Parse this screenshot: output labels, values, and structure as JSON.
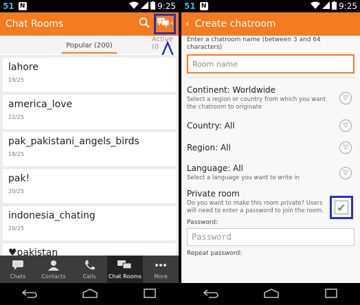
{
  "status": {
    "number": "51",
    "notif_letter": "N",
    "time": "9:25"
  },
  "left": {
    "title": "Chat Rooms",
    "tabs": {
      "popular": "Popular (200)",
      "active": "Active (0"
    },
    "rooms": [
      {
        "name": "lahore",
        "cap": "19/25"
      },
      {
        "name": "america_love",
        "cap": "22/25"
      },
      {
        "name": "pak_pakistani_angels_birds",
        "cap": "18/25"
      },
      {
        "name": "pak!",
        "cap": "20/25"
      },
      {
        "name": "indonesia_chating",
        "cap": "20/25"
      },
      {
        "name": "♥pakistan",
        "cap": ""
      }
    ],
    "nav": [
      {
        "label": "Chats",
        "icon": "chat-bubble-icon"
      },
      {
        "label": "Contacts",
        "icon": "person-icon"
      },
      {
        "label": "Calls",
        "icon": "phone-icon"
      },
      {
        "label": "Chat Rooms",
        "icon": "chat-rooms-icon"
      },
      {
        "label": "More",
        "icon": "more-dots-icon"
      }
    ]
  },
  "right": {
    "title": "Create chatroom",
    "name_hint": "Enter a chatroom name (between 3 and 64 characters)",
    "name_placeholder": "Room name",
    "continent": {
      "label": "Continent: Worldwide",
      "sub": "Select a region or country from which you want the chatroom to originate"
    },
    "country": {
      "label": "Country: All"
    },
    "region": {
      "label": "Region: All"
    },
    "language": {
      "label": "Language: All",
      "sub": "Select a language you want to write in"
    },
    "private": {
      "label": "Private room",
      "sub": "Do you want to make this room private? Users will need to enter a password to join the room."
    },
    "password_label": "Password:",
    "password_placeholder": "Password",
    "repeat_label": "Repeat password:"
  },
  "colors": {
    "accent": "#f47b20",
    "highlight": "#2b2fb8"
  }
}
